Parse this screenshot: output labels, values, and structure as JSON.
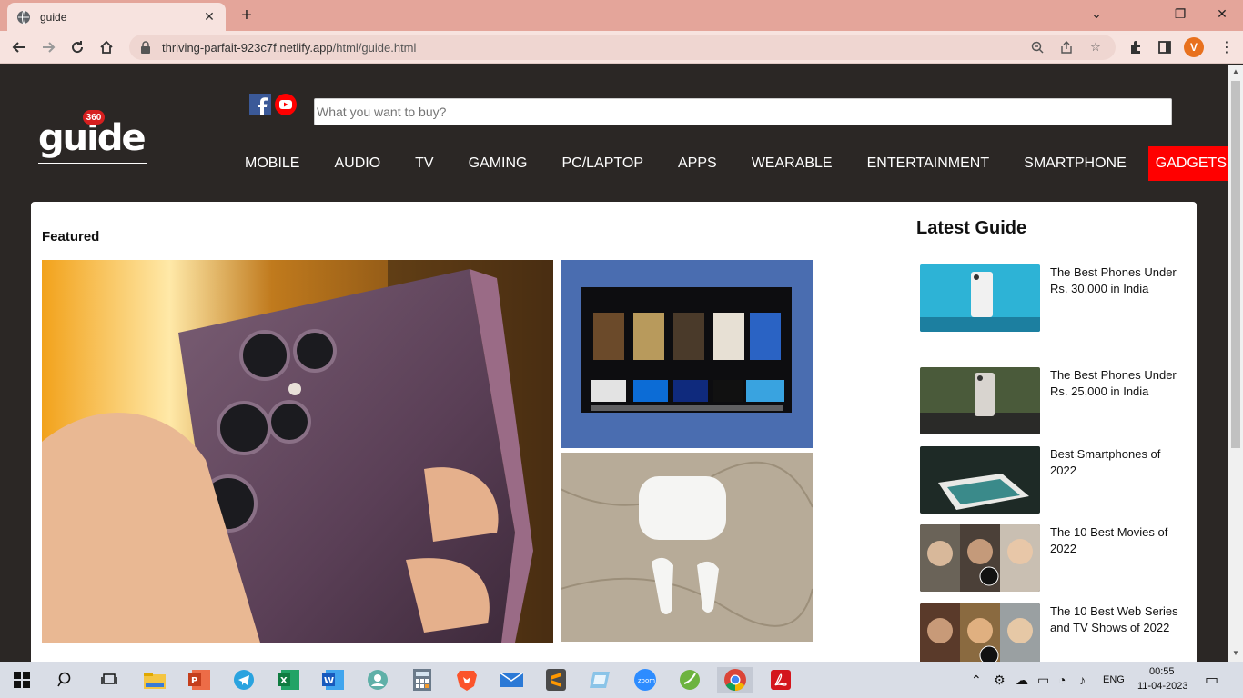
{
  "browser": {
    "tab_title": "guide",
    "url_host": "thriving-parfait-923c7f.netlify.app",
    "url_path": "/html/guide.html",
    "profile_initial": "V"
  },
  "site": {
    "logo_text": "guide",
    "logo_badge": "360",
    "search_placeholder": "What you want to buy?",
    "nav": [
      "MOBILE",
      "AUDIO",
      "TV",
      "GAMING",
      "PC/LAPTOP",
      "APPS",
      "WEARABLE",
      "ENTERTAINMENT",
      "SMARTPHONE",
      "GADGETS"
    ],
    "nav_active": "GADGETS"
  },
  "featured": {
    "heading": "Featured"
  },
  "latest": {
    "heading": "Latest Guide",
    "items": [
      {
        "title": "The Best Phones Under Rs. 30,000 in India"
      },
      {
        "title": "The Best Phones Under Rs. 25,000 in India"
      },
      {
        "title": "Best Smartphones of 2022"
      },
      {
        "title": "The 10 Best Movies of 2022"
      },
      {
        "title": "The 10 Best Web Series and TV Shows of 2022"
      }
    ]
  },
  "taskbar": {
    "lang": "ENG",
    "time": "00:55",
    "date": "11-04-2023"
  },
  "colors": {
    "page_bg": "#2b2725",
    "accent_red": "#ff0000",
    "tab_bar": "#e4a59a"
  }
}
